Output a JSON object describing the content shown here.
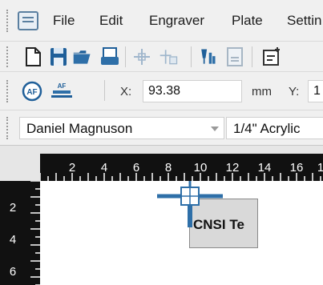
{
  "menu": {
    "items": [
      "File",
      "Edit",
      "Engraver",
      "Plate",
      "Settin"
    ]
  },
  "toolbar2": {
    "x_label": "X:",
    "x_value": "93.38",
    "unit": "mm",
    "y_label": "Y:",
    "y_value": "1",
    "af_label": "AF",
    "af2_label": "AF"
  },
  "toolbar3": {
    "user": "Daniel Magnuson",
    "material": "1/4\" Acrylic"
  },
  "ruler": {
    "top_labels": [
      "2",
      "4",
      "6",
      "8",
      "10",
      "12",
      "14",
      "16",
      "1"
    ],
    "left_labels": [
      "2",
      "4",
      "6"
    ]
  },
  "canvas": {
    "object_text": "CNSI Te"
  },
  "colors": {
    "accent": "#2e6fa8",
    "ruler_bg": "#111111",
    "object_fill": "#d9d9d9"
  }
}
